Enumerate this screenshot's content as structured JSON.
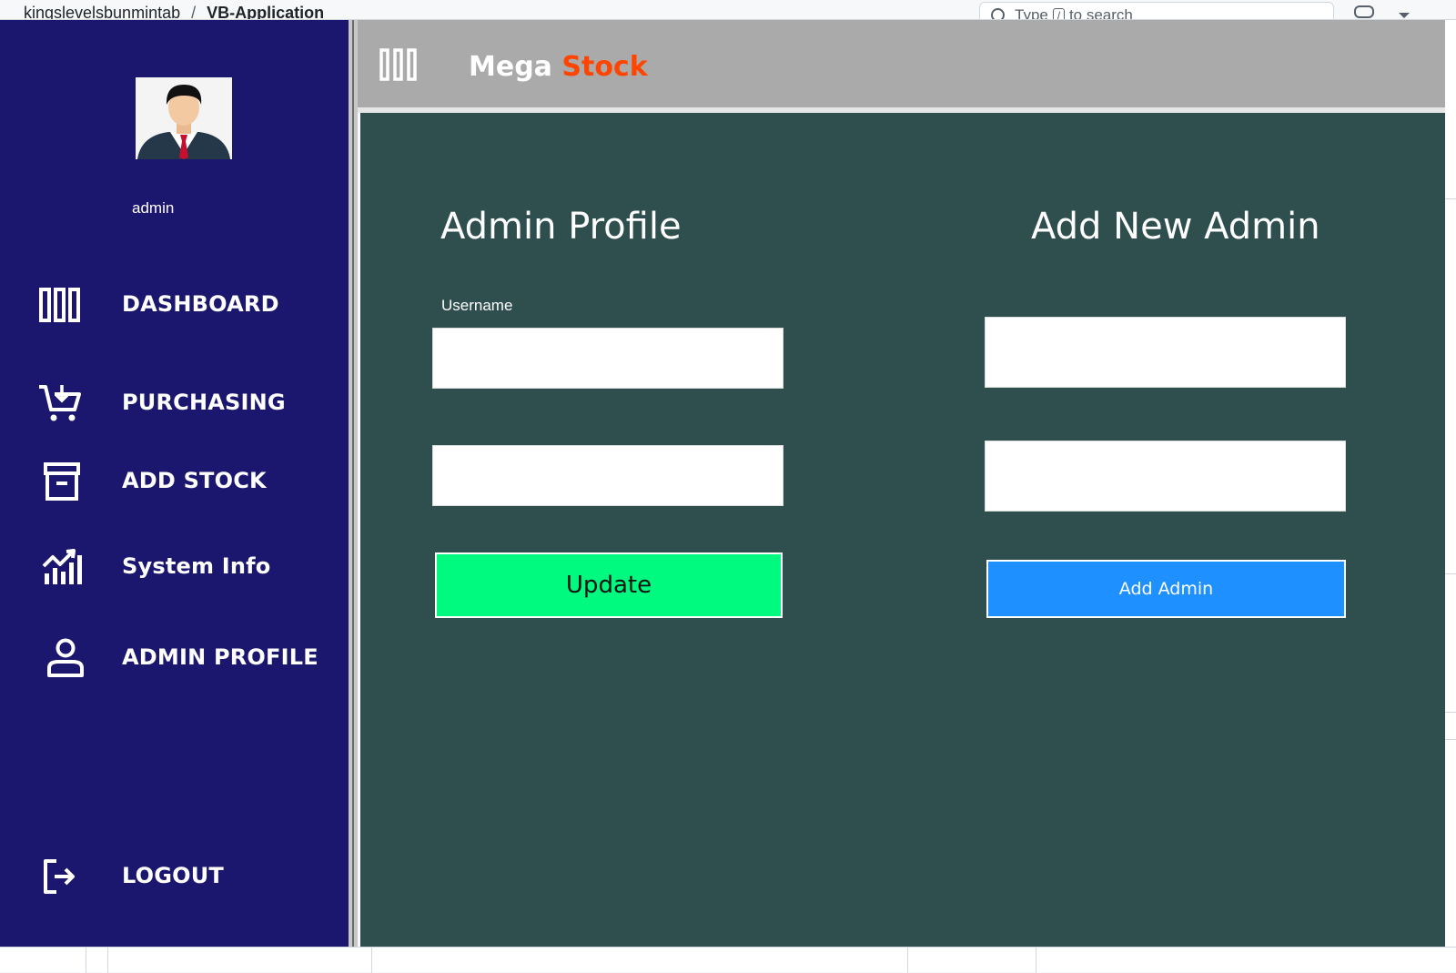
{
  "browser": {
    "breadcrumb_owner": "kingslevelsbunmintab",
    "breadcrumb_sep": "/",
    "breadcrumb_repo": "VB-Application",
    "search_placeholder_pre": "Type",
    "search_key": "/",
    "search_placeholder_post": "to search"
  },
  "app": {
    "brand_part1": "Mega",
    "brand_part2": "Stock",
    "brand_accent_color": "#ff4500"
  },
  "sidebar": {
    "user_name": "admin",
    "avatar_icon": "user-avatar-icon",
    "items": [
      {
        "label": "DASHBOARD",
        "icon": "dashboard-columns-icon"
      },
      {
        "label": "PURCHASING",
        "icon": "cart-add-icon"
      },
      {
        "label": "ADD STOCK",
        "icon": "archive-box-icon"
      },
      {
        "label": "System Info",
        "icon": "chart-growth-icon"
      },
      {
        "label": "ADMIN PROFILE",
        "icon": "person-icon"
      }
    ],
    "logout_label": "LOGOUT",
    "background_color": "#1b176e"
  },
  "admin_profile": {
    "title": "Admin Profile",
    "username_label": "Username",
    "username_value": "",
    "password_value": "",
    "update_label": "Update",
    "update_color": "#00fa7f"
  },
  "add_admin": {
    "title": "Add New Admin",
    "username_value": "",
    "password_value": "",
    "add_label": "Add Admin",
    "add_color": "#1e90ff"
  },
  "main_background_color": "#2f4f4f"
}
